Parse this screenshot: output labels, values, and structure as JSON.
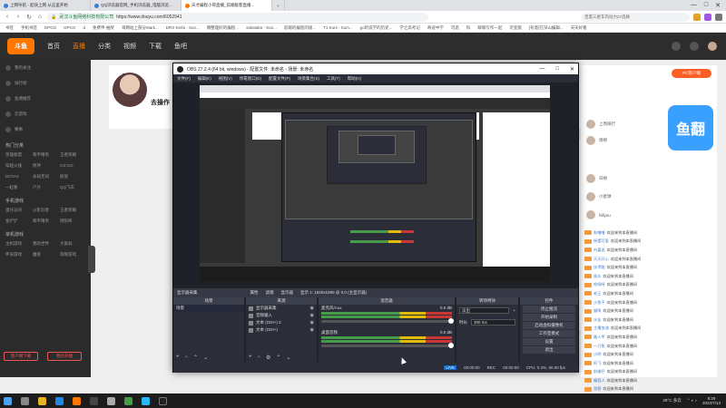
{
  "browser": {
    "tabs": [
      {
        "label": "上网导航 - 起快上网 从这里开始"
      },
      {
        "label": "QQ浏览器官网_手机浏览器_电脑浏览..."
      },
      {
        "label": "天才编程小哥直播_前端极客直播..."
      }
    ],
    "url": "https://www.douyu.com/6052941",
    "site_label": "武汉斗鱼网络科技有限公司",
    "search_placeholder": "百度三星车内动力27选择",
    "window_controls": [
      "—",
      "□",
      "✕"
    ],
    "bookmarks": [
      "书签",
      "手机书签",
      "DPGG",
      "DPGG",
      "d",
      "免费申·抽奖",
      "海网站上部分Mark...",
      "DRX Kerla - Sun...",
      "哪整理好的编程...",
      "sakataka - Sun...",
      "前端的编程的极...",
      "T1 Kuni - Sum...",
      "go听说学的历史...",
      "学之高考记",
      "奇迹中学",
      "可恶",
      "科",
      "聊聊写作一起",
      "可变版",
      "[有意]在深山编辑...",
      "天天好看"
    ]
  },
  "douyu": {
    "logo": "斗鱼",
    "nav": [
      "首页",
      "直播",
      "分类",
      "视频",
      "下载",
      "鱼吧"
    ],
    "active_nav": "直播",
    "viewers": "12",
    "stream_title": "去操作",
    "sidebar": {
      "top": [
        "我的关注",
        "排行榜",
        "鱼塘推荐",
        "云游戏",
        "赛事"
      ],
      "section1_title": "热门分类",
      "section1": [
        "英雄联盟",
        "和平精英",
        "王者荣耀",
        "穿越火线",
        "原神",
        "CS:GO",
        "DOTA2",
        "永劫无间",
        "颜值",
        "一起看",
        "户外",
        "QQ飞车"
      ],
      "section2_title": "手机游戏",
      "section2": [
        "蛋仔派对",
        "火影忍者",
        "王者荣耀",
        "金铲铲",
        "和平精英",
        "阴阳师"
      ],
      "section3_title": "单机游戏",
      "section3": [
        "主机游戏",
        "我的世界",
        "大富翁",
        "怀旧游戏",
        "魔兽",
        "策略游戏"
      ],
      "footer_buttons": [
        "客户端下载",
        "我的开播"
      ]
    },
    "right": {
      "rank_badge": "PC客户端",
      "rank_users": [
        "上周排行",
        "周榜",
        "日榜",
        "小星球",
        "hillyou"
      ],
      "mascot": "鱼翻",
      "chat": [
        {
          "nick": "啦噜噜",
          "msg": "欢迎来到本直播间"
        },
        {
          "nick": "摇摆可爱",
          "msg": "欢迎来到本直播间"
        },
        {
          "nick": "刘嘉说",
          "msg": "欢迎来到本直播间"
        },
        {
          "nick": "天天开心",
          "msg": "欢迎来到本直播间"
        },
        {
          "nick": "技术路",
          "msg": "欢迎来到本直播间"
        },
        {
          "nick": "观众",
          "msg": "欢迎来到本直播间"
        },
        {
          "nick": "哈呀呀",
          "msg": "欢迎来到本直播间"
        },
        {
          "nick": "老王",
          "msg": "欢迎来到本直播间"
        },
        {
          "nick": "小鱼干",
          "msg": "欢迎来到本直播间"
        },
        {
          "nick": "猫咪",
          "msg": "欢迎来到本直播间"
        },
        {
          "nick": "水友",
          "msg": "欢迎来到本直播间"
        },
        {
          "nick": "主播加油",
          "msg": "欢迎来到本直播间"
        },
        {
          "nick": "路人甲",
          "msg": "欢迎来到本直播间"
        },
        {
          "nick": "一只鱼",
          "msg": "欢迎来到本直播间"
        },
        {
          "nick": "小明",
          "msg": "欢迎来到本直播间"
        },
        {
          "nick": "阿飞",
          "msg": "欢迎来到本直播间"
        },
        {
          "nick": "前端仔",
          "msg": "欢迎来到本直播间"
        },
        {
          "nick": "编程人",
          "msg": "欢迎来到本直播间"
        },
        {
          "nick": "游客",
          "msg": "欢迎来到本直播间"
        },
        {
          "nick": "大白",
          "msg": "欢迎来到本直播间"
        },
        {
          "nick": "星星",
          "msg": "欢迎来到本直播间"
        },
        {
          "nick": "晚安",
          "msg": "欢迎来到本直播间"
        }
      ]
    }
  },
  "obs": {
    "title": "OBS 27.2.4 (64 bit, windows) - 配置文件: 未命名 - 场景: 未命名",
    "menu": [
      "文件(F)",
      "编辑(E)",
      "视图(V)",
      "停靠窗口(D)",
      "配置文件(P)",
      "场景集合(S)",
      "工具(T)",
      "帮助(H)"
    ],
    "scenebar": {
      "scene_label": "显示器采集",
      "props": "属性",
      "filters": "滤镜",
      "display": "显示器",
      "display_value": "显示 1: 1920x1080 @ 0,0 (主显示器)"
    },
    "docks": {
      "scenes_title": "场景",
      "scenes": [
        "场景"
      ],
      "sources_title": "来源",
      "sources": [
        "显示器采集",
        "音频输入",
        "文本 (GDI+) 2",
        "文本 (GDI+)"
      ],
      "mixer_title": "混音器",
      "mixer": [
        {
          "name": "麦克风/Aux",
          "db": "0.0 dB"
        },
        {
          "name": "桌面音频",
          "db": "0.0 dB"
        }
      ],
      "transition_title": "转场特效",
      "transition": {
        "type": "淡出",
        "duration_label": "时长",
        "duration": "300 ms"
      },
      "controls_title": "控件",
      "controls": [
        "停止推流",
        "开始录制",
        "启动虚拟摄像机",
        "工作室模式",
        "设置",
        "退出"
      ]
    },
    "status": {
      "live": "LIVE",
      "live_time": "00:00:00",
      "rec": "REC",
      "rec_time": "00:00:00",
      "cpu": "CPU: 0.3%, 60.00 fps"
    }
  },
  "taskbar": {
    "weather": "29°C 多云",
    "time": "8:29",
    "date": "2022/7/13"
  },
  "colors": {
    "douyu_orange": "#ff7700",
    "obs_bg": "#2b2e38"
  }
}
